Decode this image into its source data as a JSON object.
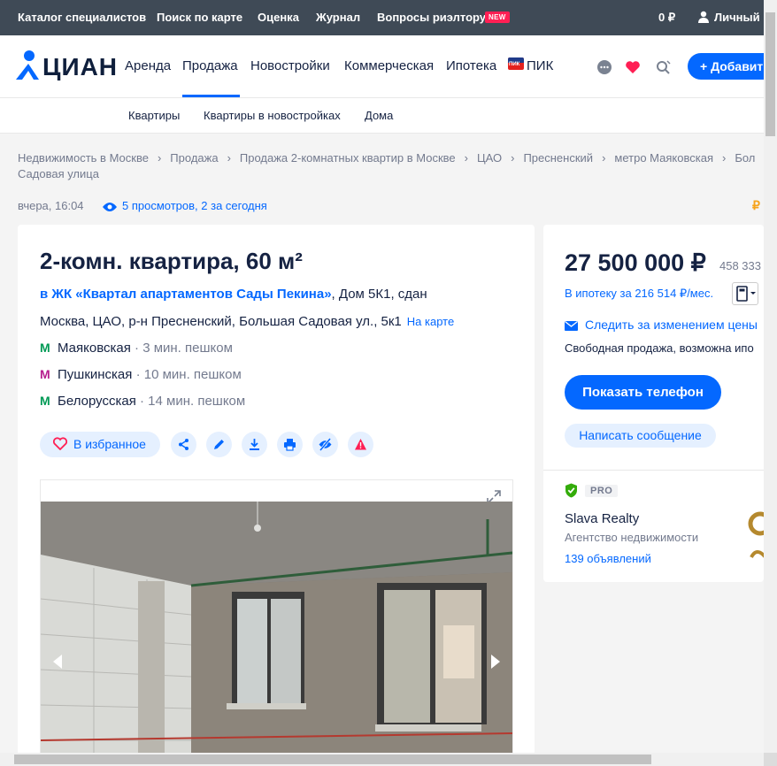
{
  "topbar": {
    "links": [
      "Каталог специалистов",
      "Поиск по карте",
      "Оценка",
      "Журнал",
      "Вопросы риэлтору"
    ],
    "new_badge": "NEW",
    "balance": "0 ₽",
    "account": "Личный к"
  },
  "header": {
    "logo": "ЦИАН",
    "nav": [
      "Аренда",
      "Продажа",
      "Новостройки",
      "Коммерческая",
      "Ипотека",
      "ПИК"
    ],
    "active_nav": "Продажа",
    "add_button": "+ Добавит",
    "pik_logo_text": "ПИК"
  },
  "subnav": [
    "Квартиры",
    "Квартиры в новостройках",
    "Дома"
  ],
  "breadcrumbs": [
    "Недвижимость в Москве",
    "Продажа",
    "Продажа 2-комнатных квартир в Москве",
    "ЦАО",
    "Пресненский",
    "метро Маяковская",
    "Бол"
  ],
  "breadcrumb_line2": "Садовая улица",
  "meta": {
    "published": "вчера, 16:04",
    "views": "5 просмотров, 2 за сегодня",
    "edge_symbol": "₽"
  },
  "listing": {
    "title": "2-комн. квартира, 60 м²",
    "complex_link": "в ЖК «Квартал апартаментов Сады Пекина»",
    "complex_rest": ", Дом 5К1, сдан",
    "address": "Москва, ЦАО, р-н Пресненский, Большая Садовая ул., 5к1",
    "map_link": "На карте",
    "metro": [
      {
        "name": "Маяковская",
        "walk": "· 3 мин. пешком",
        "color": "#029a55"
      },
      {
        "name": "Пушкинская",
        "walk": "· 10 мин. пешком",
        "color": "#b61d8e"
      },
      {
        "name": "Белорусская",
        "walk": "· 14 мин. пешком",
        "color": "#029a55"
      }
    ],
    "favorite_label": "В избранное",
    "action_icons": [
      "share-icon",
      "edit-icon",
      "download-icon",
      "print-icon",
      "hide-icon",
      "complain-icon"
    ]
  },
  "price_card": {
    "price": "27 500 000 ₽",
    "price_per_m2": "458 333",
    "mortgage": "В ипотеку за 216 514 ₽/мес.",
    "follow": "Следить за изменением цены",
    "sale_type": "Свободная продажа, возможна ипо",
    "phone_button": "Показать телефон",
    "message_button": "Написать сообщение",
    "pro_badge": "PRO",
    "agency_name": "Slava Realty",
    "agency_type": "Агентство недвижимости",
    "agency_ads": "139 объявлений"
  },
  "colors": {
    "accent": "#0468ff",
    "topbar": "#3f4a56",
    "text": "#152242",
    "muted": "#737a8e",
    "new_badge": "#ff1f54"
  }
}
